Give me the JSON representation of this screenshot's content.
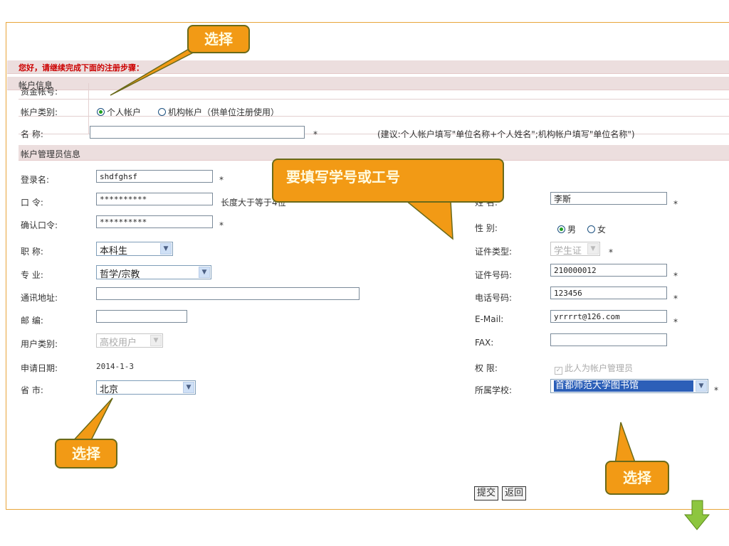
{
  "greeting": "您好，请继续完成下面的注册步骤：",
  "account_section": "帐户信息",
  "fund_account_label": "资金帐号:",
  "account_type_label": "帐户类别:",
  "account_type_personal": "个人帐户",
  "account_type_org": "机构帐户（供单位注册使用）",
  "name_label": "名 称:",
  "name_value": "",
  "required_mark": "*",
  "name_hint": "(建议:个人帐户填写\"单位名称+个人姓名\";机构帐户填写\"单位名称\")",
  "admin_section": "帐户管理员信息",
  "left": {
    "login_label": "登录名:",
    "login_value": "shdfghsf",
    "pwd_label": "口 令:",
    "pwd_value": "**********",
    "pwd_hint": "长度大于等于4位",
    "pwd2_label": "确认口令:",
    "pwd2_value": "**********",
    "title_label": "职 称:",
    "title_value": "本科生",
    "major_label": "专 业:",
    "major_value": "哲学/宗教",
    "addr_label": "通讯地址:",
    "addr_value": "",
    "zip_label": "邮 编:",
    "zip_value": "",
    "usertype_label": "用户类别:",
    "usertype_value": "高校用户",
    "date_label": "申请日期:",
    "date_value": "2014-1-3",
    "province_label": "省 市:",
    "province_value": "北京"
  },
  "right": {
    "name_label": "姓 名:",
    "name_value": "李斯",
    "gender_label": "性 别:",
    "gender_male": "男",
    "gender_female": "女",
    "idtype_label": "证件类型:",
    "idtype_value": "学生证",
    "idno_label": "证件号码:",
    "idno_value": "210000012",
    "phone_label": "电话号码:",
    "phone_value": "123456",
    "email_label": "E-Mail:",
    "email_value": "yrrrrt@126.com",
    "fax_label": "FAX:",
    "fax_value": "",
    "perm_label": "权 限:",
    "perm_value": "此人为帐户管理员",
    "school_label": "所属学校:",
    "school_value": "首都师范大学图书馆"
  },
  "submit_label": "提交",
  "back_label": "返回",
  "callouts": {
    "top": "选择",
    "middle": "要填写学号或工号",
    "bottom_left": "选择",
    "bottom_right": "选择"
  },
  "colors": {
    "greeting": "#cc0000",
    "callout_fill": "#f29a15",
    "header_bg": "#ecdede",
    "arrow": "#8dc63f"
  }
}
